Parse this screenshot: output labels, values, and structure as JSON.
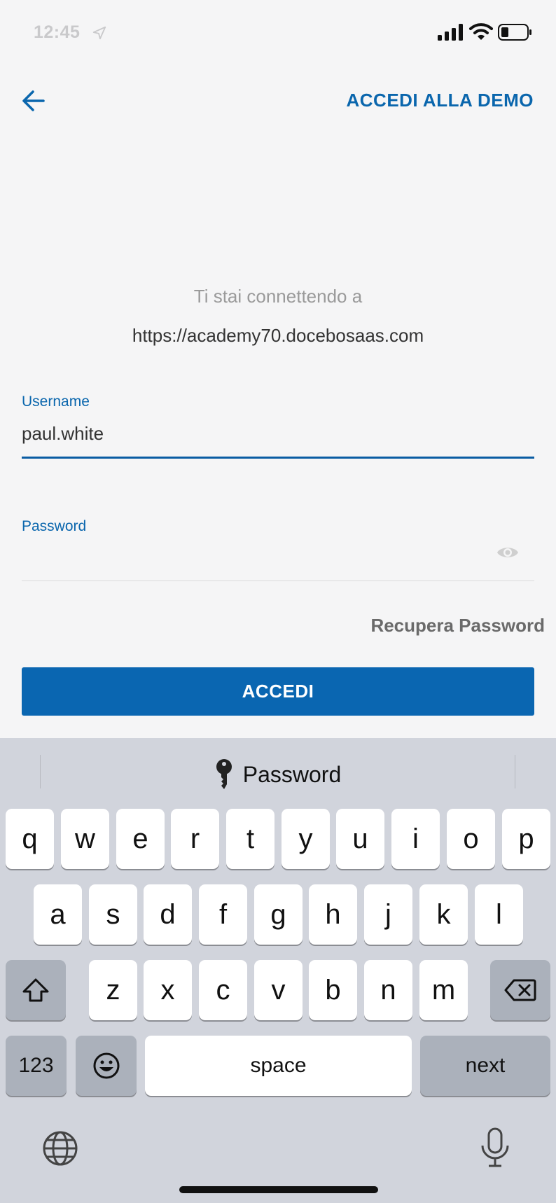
{
  "status_bar": {
    "time": "12:45",
    "icons": [
      "location-icon",
      "cellular-signal-icon",
      "wifi-icon",
      "battery-icon"
    ]
  },
  "nav": {
    "back_icon": "arrow-left-icon",
    "demo_link": "ACCEDI ALLA DEMO"
  },
  "connection": {
    "intro": "Ti stai connettendo a",
    "url": "https://academy70.docebosaas.com"
  },
  "form": {
    "username_label": "Username",
    "username_value": "paul.white",
    "password_label": "Password",
    "password_toggle_icon": "eye-icon",
    "recover_link": "Recupera Password",
    "submit_label": "ACCEDI"
  },
  "colors": {
    "accent": "#0a66b1",
    "keyboard_bg": "#d1d4dc"
  },
  "keyboard": {
    "suggestion": "Password",
    "suggestion_icon": "key-icon",
    "row1": [
      "q",
      "w",
      "e",
      "r",
      "t",
      "y",
      "u",
      "i",
      "o",
      "p"
    ],
    "row2": [
      "a",
      "s",
      "d",
      "f",
      "g",
      "h",
      "j",
      "k",
      "l"
    ],
    "row3": [
      "z",
      "x",
      "c",
      "v",
      "b",
      "n",
      "m"
    ],
    "numbers_label": "123",
    "space_label": "space",
    "next_label": "next",
    "shift_icon": "shift-icon",
    "delete_icon": "backspace-icon",
    "emoji_icon": "emoji-icon",
    "globe_icon": "globe-icon",
    "mic_icon": "microphone-icon"
  }
}
